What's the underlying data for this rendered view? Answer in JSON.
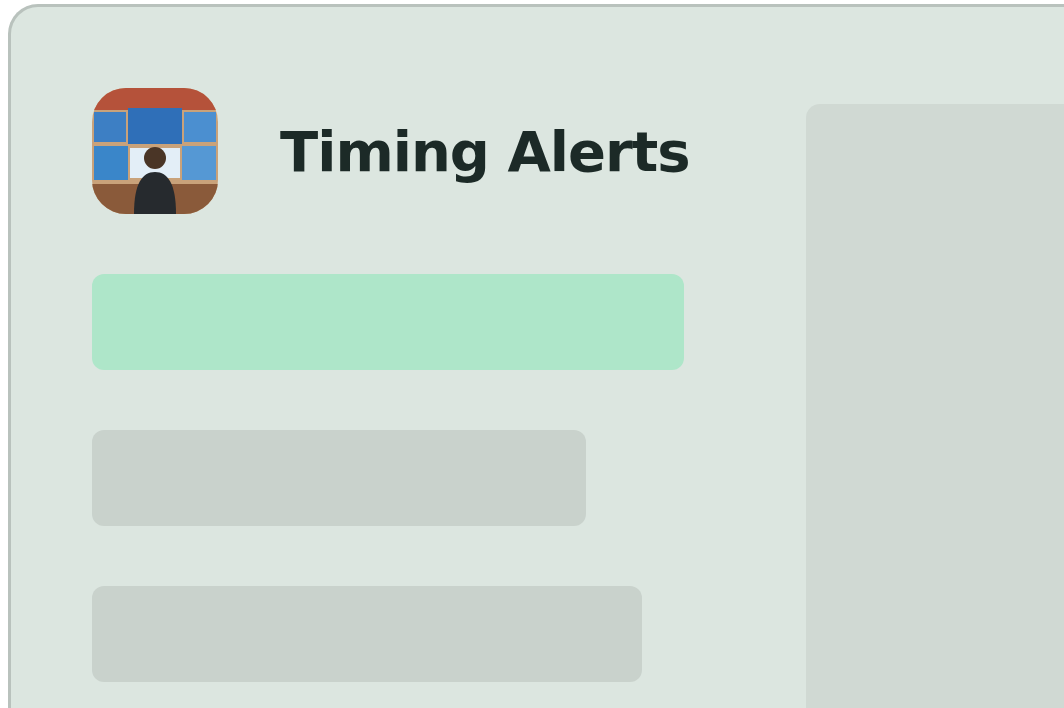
{
  "app": {
    "title": "Timing Alerts"
  },
  "items": [
    {
      "selected": true
    },
    {
      "selected": false
    },
    {
      "selected": false
    }
  ]
}
